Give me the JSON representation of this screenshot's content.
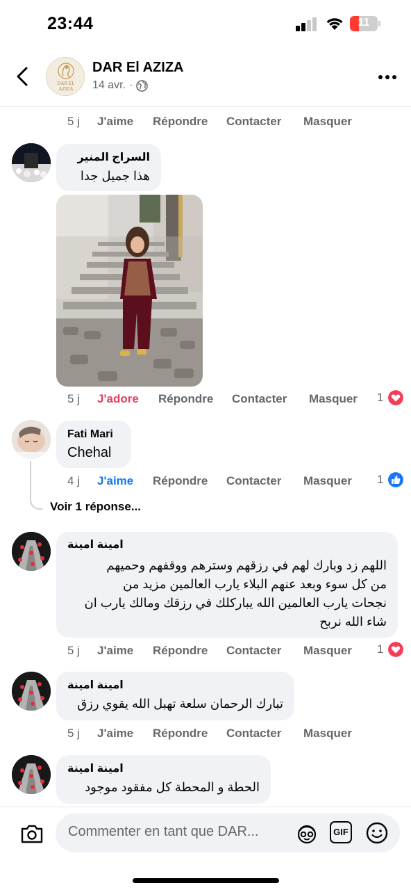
{
  "status_bar": {
    "time": "23:44",
    "battery": "11"
  },
  "header": {
    "page_name": "DAR El AZIZA",
    "date": "14 avr.",
    "separator": "·",
    "logo_text": "DAR EL\nAZIZA"
  },
  "actions": {
    "like": "J'aime",
    "love": "J'adore",
    "reply": "Répondre",
    "contact": "Contacter",
    "hide": "Masquer"
  },
  "comments": [
    {
      "age": "5 j"
    },
    {
      "author": "السراج المنير",
      "text": "هذا جميل جدا",
      "age": "5 j",
      "reaction": "J'adore",
      "reaction_count": "1",
      "reaction_icon": "heart-icon"
    },
    {
      "author": "Fati Mari",
      "text": "Chehal",
      "age": "4 j",
      "reaction": "J'aime",
      "reaction_count": "1",
      "reaction_icon": "thumbs-up-icon",
      "replies_link": "Voir 1 réponse..."
    },
    {
      "author": "امينة امينة",
      "lines": [
        "اللهم زد وبارك لهم في رزقهم وسترهم ووقفهم وحميهم",
        "من كل سوء وبعد عنهم البلاء يارب العالمين مزيد من",
        "نجحات يارب العالمين الله يباركلك في رزقك ومالك يارب ان",
        "شاء الله نربح"
      ],
      "age": "5 j",
      "reaction_count": "1",
      "reaction_icon": "heart-icon"
    },
    {
      "author": "امينة امينة",
      "text": "تبارك الرحمان سلعة تهبل الله يقوي رزق",
      "age": "5 j"
    },
    {
      "author": "امينة امينة",
      "text": "الحطة و المحطة كل مفقود موجود"
    }
  ],
  "composer": {
    "placeholder": "Commenter en tant que DAR...",
    "gif_label": "GIF"
  },
  "colors": {
    "love_red": "#e4405f",
    "heart_red": "#f33e58",
    "like_blue": "#1877f2",
    "meta_gray": "#65676b",
    "bubble_gray": "#f0f2f5",
    "battery_red": "#ff3b30"
  }
}
